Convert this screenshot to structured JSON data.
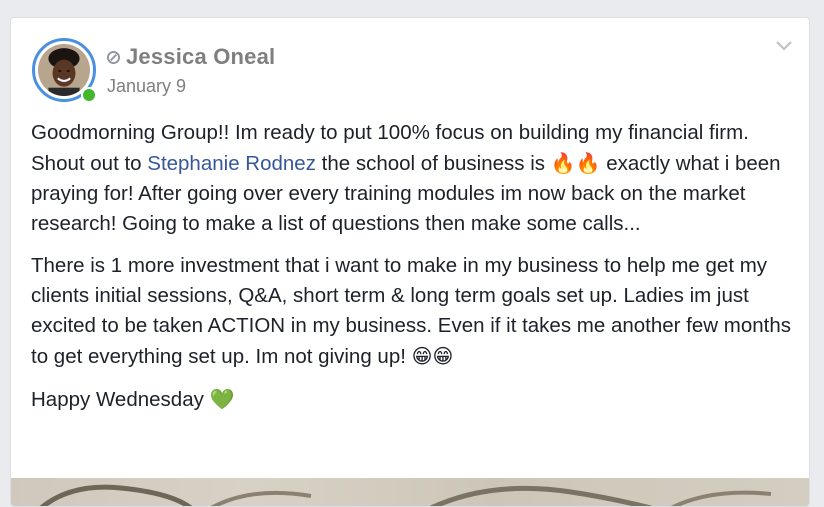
{
  "post": {
    "author": "Jessica Oneal",
    "date": "January 9",
    "mention": "Stephanie Rodnez",
    "p1_before": "Goodmorning Group!! Im ready to put 100% focus on building my financial firm. Shout out to ",
    "p1_after": " the school of business is ",
    "p1_emoji": "🔥🔥",
    "p1_rest": " exactly what i been praying for! After going over every training modules im now back on the market research! Going to make a list of questions then make some calls...",
    "p2_text": "There is 1 more investment that i want to make in my business to help me get my clients initial sessions, Q&A, short term & long term goals set up. Ladies im just excited to be taken ACTION in my business. Even if it takes me another few months to get everything set up. Im not giving up! ",
    "p2_emoji": "😁😁",
    "p3_text": "Happy Wednesday ",
    "p3_emoji": "💚"
  },
  "icons": {
    "admin_badge": "admin-badge-icon",
    "chevron": "chevron-down-icon"
  },
  "colors": {
    "mention": "#365899",
    "name": "#7f7f7f",
    "online": "#42b72a",
    "avatar_ring": "#4a90e2"
  }
}
